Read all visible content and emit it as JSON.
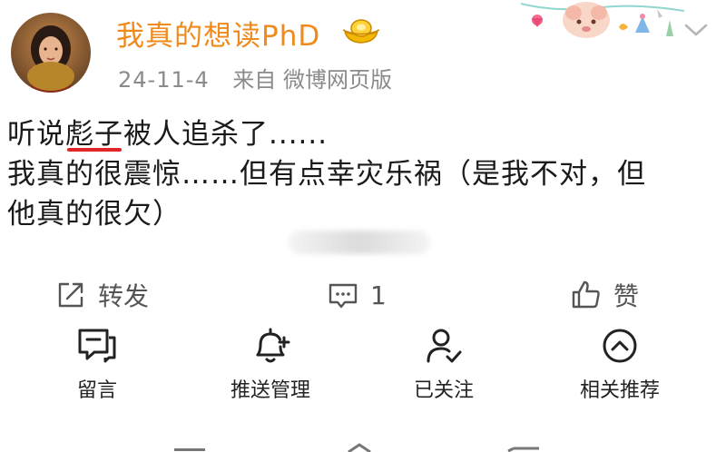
{
  "author": {
    "name": "我真的想读PhD",
    "badge_icon": "gold-ingot-icon"
  },
  "meta": {
    "date": "24-11-4",
    "source": "来自 微博网页版"
  },
  "post": {
    "line1_before": "听说",
    "line1_highlight": "彪子",
    "line1_after": "被人追杀了......",
    "line2": "我真的很震惊……但有点幸灾乐祸（是我不对，但",
    "line3": "他真的很欠）",
    "highlight_color": "#e0262b"
  },
  "actions": {
    "repost_label": "转发",
    "comment_count": "1",
    "like_label": "赞"
  },
  "bottom_actions": [
    {
      "label": "留言",
      "icon": "message-icon"
    },
    {
      "label": "推送管理",
      "icon": "bell-plus-icon"
    },
    {
      "label": "已关注",
      "icon": "user-check-icon"
    },
    {
      "label": "相关推荐",
      "icon": "chevron-up-circle-icon"
    }
  ],
  "colors": {
    "username": "#f08a1c",
    "meta": "#8a8a8a",
    "body_text": "#1a1a1a"
  }
}
